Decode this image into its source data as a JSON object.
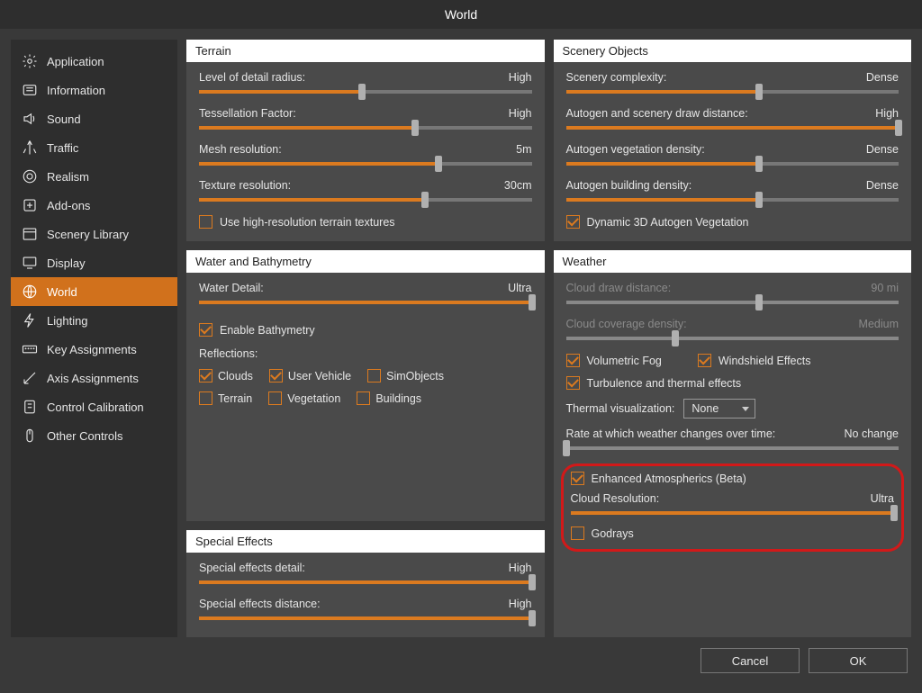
{
  "title": "World",
  "sidebar": {
    "items": [
      {
        "label": "Application",
        "icon": "gear"
      },
      {
        "label": "Information",
        "icon": "info"
      },
      {
        "label": "Sound",
        "icon": "sound"
      },
      {
        "label": "Traffic",
        "icon": "traffic"
      },
      {
        "label": "Realism",
        "icon": "target"
      },
      {
        "label": "Add-ons",
        "icon": "addon"
      },
      {
        "label": "Scenery Library",
        "icon": "library"
      },
      {
        "label": "Display",
        "icon": "display"
      },
      {
        "label": "World",
        "icon": "globe",
        "active": true
      },
      {
        "label": "Lighting",
        "icon": "lighting"
      },
      {
        "label": "Key Assignments",
        "icon": "keyboard"
      },
      {
        "label": "Axis Assignments",
        "icon": "axis"
      },
      {
        "label": "Control Calibration",
        "icon": "calib"
      },
      {
        "label": "Other Controls",
        "icon": "mouse"
      }
    ]
  },
  "terrain": {
    "title": "Terrain",
    "lod": {
      "label": "Level of detail radius:",
      "value": "High",
      "fill": 49
    },
    "tess": {
      "label": "Tessellation Factor:",
      "value": "High",
      "fill": 65
    },
    "mesh": {
      "label": "Mesh resolution:",
      "value": "5m",
      "fill": 72
    },
    "tex": {
      "label": "Texture resolution:",
      "value": "30cm",
      "fill": 68
    },
    "hires": {
      "label": "Use high-resolution terrain textures",
      "checked": false
    }
  },
  "water": {
    "title": "Water and Bathymetry",
    "detail": {
      "label": "Water Detail:",
      "value": "Ultra",
      "fill": 100
    },
    "bathy": {
      "label": "Enable Bathymetry",
      "checked": true
    },
    "reflections_label": "Reflections:",
    "refl": {
      "clouds": {
        "label": "Clouds",
        "checked": true
      },
      "vehicle": {
        "label": "User Vehicle",
        "checked": true
      },
      "sim": {
        "label": "SimObjects",
        "checked": false
      },
      "terrain": {
        "label": "Terrain",
        "checked": false
      },
      "veg": {
        "label": "Vegetation",
        "checked": false
      },
      "build": {
        "label": "Buildings",
        "checked": false
      }
    }
  },
  "sfx": {
    "title": "Special Effects",
    "detail": {
      "label": "Special effects detail:",
      "value": "High",
      "fill": 100
    },
    "distance": {
      "label": "Special effects distance:",
      "value": "High",
      "fill": 100
    }
  },
  "scenery": {
    "title": "Scenery Objects",
    "complexity": {
      "label": "Scenery complexity:",
      "value": "Dense",
      "fill": 58
    },
    "draw": {
      "label": "Autogen and scenery draw distance:",
      "value": "High",
      "fill": 100
    },
    "veg": {
      "label": "Autogen vegetation density:",
      "value": "Dense",
      "fill": 58
    },
    "build": {
      "label": "Autogen building density:",
      "value": "Dense",
      "fill": 58
    },
    "dyn3d": {
      "label": "Dynamic 3D Autogen Vegetation",
      "checked": true
    }
  },
  "weather": {
    "title": "Weather",
    "clouddraw": {
      "label": "Cloud draw distance:",
      "value": "90 mi",
      "fill": 58,
      "disabled": true
    },
    "coverage": {
      "label": "Cloud coverage density:",
      "value": "Medium",
      "fill": 33,
      "disabled": true
    },
    "volfog": {
      "label": "Volumetric Fog",
      "checked": true
    },
    "wind": {
      "label": "Windshield Effects",
      "checked": true
    },
    "turb": {
      "label": "Turbulence and thermal effects",
      "checked": true
    },
    "thermal_label": "Thermal visualization:",
    "thermal_value": "None",
    "rate_label": "Rate at which weather changes over time:",
    "rate_value": "No change",
    "rate_fill": 0,
    "enhanced": {
      "label": "Enhanced Atmospherics (Beta)",
      "checked": true
    },
    "cloudres": {
      "label": "Cloud Resolution:",
      "value": "Ultra",
      "fill": 100
    },
    "godrays": {
      "label": "Godrays",
      "checked": false
    }
  },
  "footer": {
    "cancel": "Cancel",
    "ok": "OK"
  }
}
